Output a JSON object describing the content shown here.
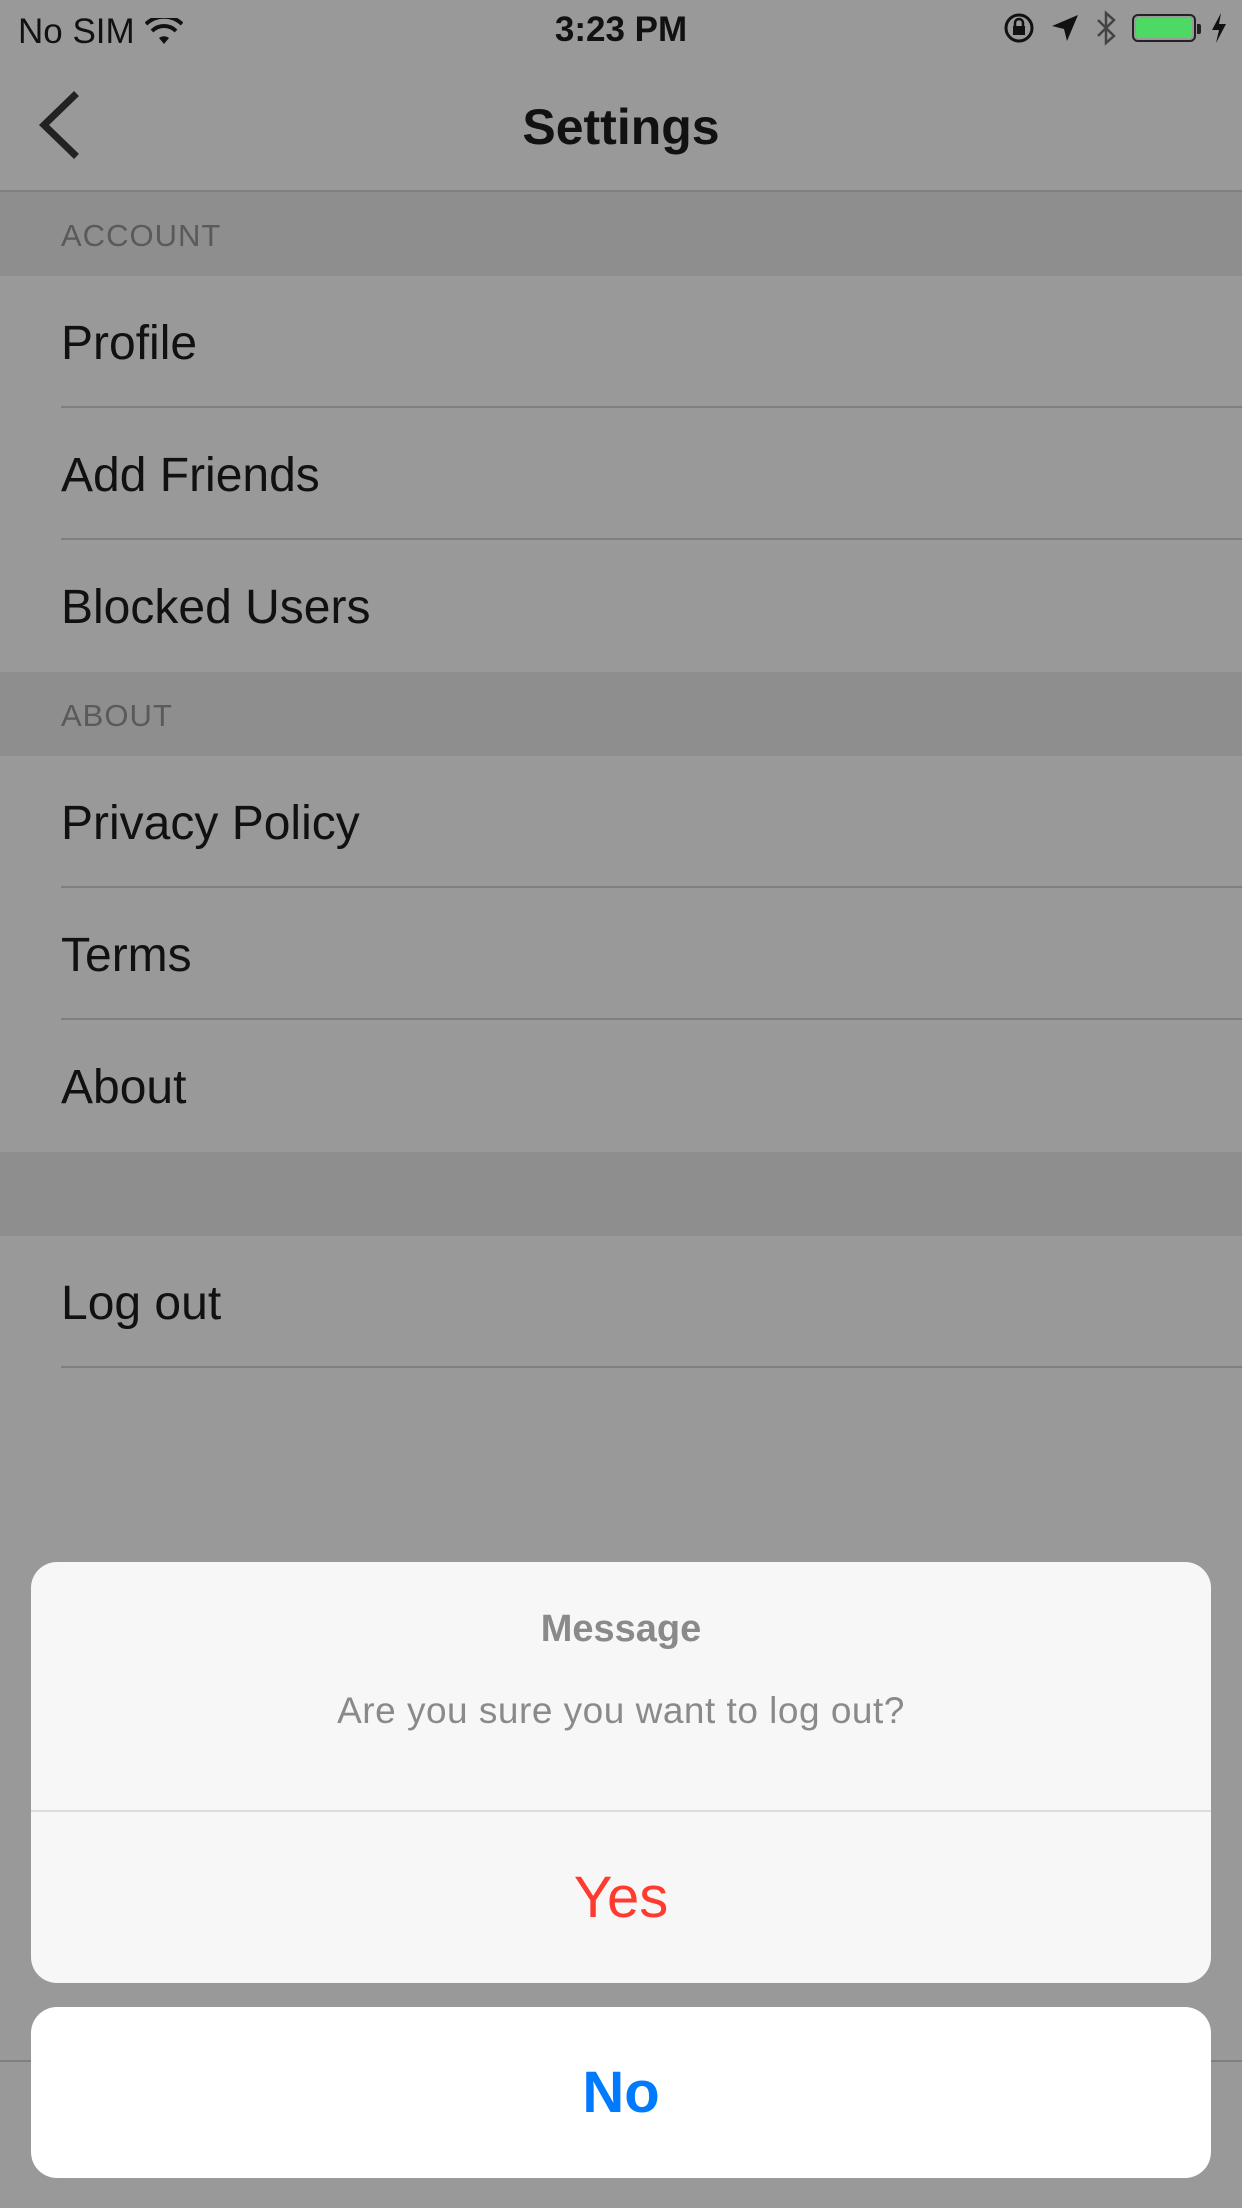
{
  "status_bar": {
    "carrier": "No SIM",
    "time": "3:23 PM",
    "battery_level": 1.0,
    "icons": [
      "wifi-icon",
      "orientation-lock-icon",
      "location-arrow-icon",
      "bluetooth-icon",
      "battery-icon",
      "charging-bolt-icon"
    ]
  },
  "nav": {
    "title": "Settings",
    "back_icon": "chevron-left-icon"
  },
  "sections": {
    "account": {
      "header": "ACCOUNT",
      "items": [
        "Profile",
        "Add Friends",
        "Blocked Users"
      ]
    },
    "about": {
      "header": "ABOUT",
      "items": [
        "Privacy Policy",
        "Terms",
        "About"
      ]
    },
    "session": {
      "items": [
        "Log out"
      ]
    }
  },
  "alert": {
    "title": "Message",
    "message": "Are you sure you want to log out?",
    "confirm_label": "Yes",
    "cancel_label": "No",
    "confirm_color": "#ff3b30",
    "cancel_color": "#007aff"
  }
}
